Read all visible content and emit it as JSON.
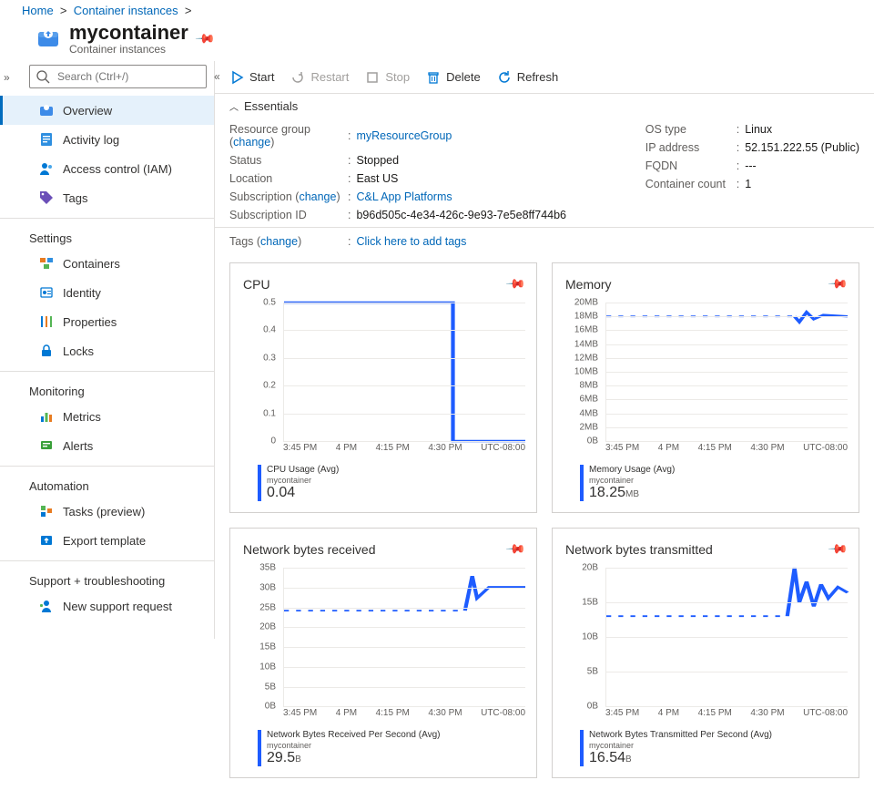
{
  "breadcrumbs": [
    "Home",
    "Container instances"
  ],
  "resource": {
    "name": "mycontainer",
    "type": "Container instances"
  },
  "search": {
    "placeholder": "Search (Ctrl+/)"
  },
  "sidebar": {
    "top": [
      {
        "label": "Overview",
        "icon": "container"
      },
      {
        "label": "Activity log",
        "icon": "log"
      },
      {
        "label": "Access control (IAM)",
        "icon": "iam"
      },
      {
        "label": "Tags",
        "icon": "tag"
      }
    ],
    "groups": [
      {
        "title": "Settings",
        "items": [
          {
            "label": "Containers",
            "icon": "containers"
          },
          {
            "label": "Identity",
            "icon": "identity"
          },
          {
            "label": "Properties",
            "icon": "props"
          },
          {
            "label": "Locks",
            "icon": "lock"
          }
        ]
      },
      {
        "title": "Monitoring",
        "items": [
          {
            "label": "Metrics",
            "icon": "metrics"
          },
          {
            "label": "Alerts",
            "icon": "alerts"
          }
        ]
      },
      {
        "title": "Automation",
        "items": [
          {
            "label": "Tasks (preview)",
            "icon": "tasks"
          },
          {
            "label": "Export template",
            "icon": "export"
          }
        ]
      },
      {
        "title": "Support + troubleshooting",
        "items": [
          {
            "label": "New support request",
            "icon": "support"
          }
        ]
      }
    ]
  },
  "commands": {
    "start": "Start",
    "restart": "Restart",
    "stop": "Stop",
    "delete": "Delete",
    "refresh": "Refresh"
  },
  "essentials": {
    "header": "Essentials",
    "left": {
      "resource_group_k": "Resource group",
      "change": "change",
      "resource_group_v": "myResourceGroup",
      "status_k": "Status",
      "status_v": "Stopped",
      "location_k": "Location",
      "location_v": "East US",
      "subscription_k": "Subscription",
      "subscription_v": "C&L App Platforms",
      "subid_k": "Subscription ID",
      "subid_v": "b96d505c-4e34-426c-9e93-7e5e8ff744b6"
    },
    "right": {
      "os_k": "OS type",
      "os_v": "Linux",
      "ip_k": "IP address",
      "ip_v": "52.151.222.55 (Public)",
      "fqdn_k": "FQDN",
      "fqdn_v": "---",
      "count_k": "Container count",
      "count_v": "1"
    },
    "tags_k": "Tags",
    "tags_change": "change",
    "tags_v": "Click here to add tags"
  },
  "charts": {
    "cpu": {
      "title": "CPU",
      "yticks": [
        "0.5",
        "0.4",
        "0.3",
        "0.2",
        "0.1",
        "0"
      ],
      "xticks": [
        "3:45 PM",
        "4 PM",
        "4:15 PM",
        "4:30 PM",
        "UTC-08:00"
      ],
      "legend": "CPU Usage (Avg)",
      "sub": "mycontainer",
      "value": "0.04",
      "unit": ""
    },
    "mem": {
      "title": "Memory",
      "yticks": [
        "20MB",
        "18MB",
        "16MB",
        "14MB",
        "12MB",
        "10MB",
        "8MB",
        "6MB",
        "4MB",
        "2MB",
        "0B"
      ],
      "xticks": [
        "3:45 PM",
        "4 PM",
        "4:15 PM",
        "4:30 PM",
        "UTC-08:00"
      ],
      "legend": "Memory Usage (Avg)",
      "sub": "mycontainer",
      "value": "18.25",
      "unit": "MB"
    },
    "rx": {
      "title": "Network bytes received",
      "yticks": [
        "35B",
        "30B",
        "25B",
        "20B",
        "15B",
        "10B",
        "5B",
        "0B"
      ],
      "xticks": [
        "3:45 PM",
        "4 PM",
        "4:15 PM",
        "4:30 PM",
        "UTC-08:00"
      ],
      "legend": "Network Bytes Received Per Second (Avg)",
      "sub": "mycontainer",
      "value": "29.5",
      "unit": "B"
    },
    "tx": {
      "title": "Network bytes transmitted",
      "yticks": [
        "20B",
        "15B",
        "10B",
        "5B",
        "0B"
      ],
      "xticks": [
        "3:45 PM",
        "4 PM",
        "4:15 PM",
        "4:30 PM",
        "UTC-08:00"
      ],
      "legend": "Network Bytes Transmitted Per Second (Avg)",
      "sub": "mycontainer",
      "value": "16.54",
      "unit": "B"
    }
  },
  "chart_data": [
    {
      "type": "line",
      "title": "CPU",
      "xlabel": "",
      "ylabel": "CPU Usage",
      "ylim": [
        0,
        0.5
      ],
      "x": [
        "3:45 PM",
        "4:00 PM",
        "4:15 PM",
        "4:25 PM",
        "4:30 PM",
        "4:40 PM"
      ],
      "series": [
        {
          "name": "CPU Usage (Avg) — mycontainer",
          "values": [
            0.5,
            0.5,
            0.5,
            0.5,
            0.0,
            0.0
          ]
        }
      ],
      "avg_line": 0.04,
      "summary": 0.04,
      "timezone": "UTC-08:00"
    },
    {
      "type": "line",
      "title": "Memory",
      "xlabel": "",
      "ylabel": "Memory",
      "ylim": [
        0,
        20
      ],
      "yunit": "MB",
      "x": [
        "3:45 PM",
        "4:00 PM",
        "4:15 PM",
        "4:30 PM",
        "4:32 PM",
        "4:35 PM",
        "4:40 PM"
      ],
      "series": [
        {
          "name": "Memory Usage (Avg) — mycontainer",
          "values": [
            18,
            18,
            18,
            18,
            17,
            18.5,
            18
          ]
        }
      ],
      "avg_line": 18.25,
      "summary": 18.25,
      "timezone": "UTC-08:00"
    },
    {
      "type": "line",
      "title": "Network bytes received",
      "xlabel": "",
      "ylabel": "Bytes/s",
      "ylim": [
        0,
        35
      ],
      "yunit": "B",
      "x": [
        "3:45 PM",
        "4:00 PM",
        "4:15 PM",
        "4:25 PM",
        "4:27 PM",
        "4:30 PM",
        "4:35 PM",
        "4:40 PM"
      ],
      "series": [
        {
          "name": "Network Bytes Received Per Second (Avg) — mycontainer",
          "values": [
            24,
            24,
            24,
            24,
            33,
            27,
            30,
            30
          ]
        }
      ],
      "avg_line": 29.5,
      "summary": 29.5,
      "timezone": "UTC-08:00"
    },
    {
      "type": "line",
      "title": "Network bytes transmitted",
      "xlabel": "",
      "ylabel": "Bytes/s",
      "ylim": [
        0,
        20
      ],
      "yunit": "B",
      "x": [
        "3:45 PM",
        "4:00 PM",
        "4:15 PM",
        "4:25 PM",
        "4:28 PM",
        "4:30 PM",
        "4:32 PM",
        "4:35 PM",
        "4:38 PM",
        "4:40 PM"
      ],
      "series": [
        {
          "name": "Network Bytes Transmitted Per Second (Avg) — mycontainer",
          "values": [
            13,
            13,
            13,
            13,
            20,
            15,
            18,
            15,
            17,
            16.5
          ]
        }
      ],
      "avg_line": 16.54,
      "summary": 16.54,
      "timezone": "UTC-08:00"
    }
  ]
}
